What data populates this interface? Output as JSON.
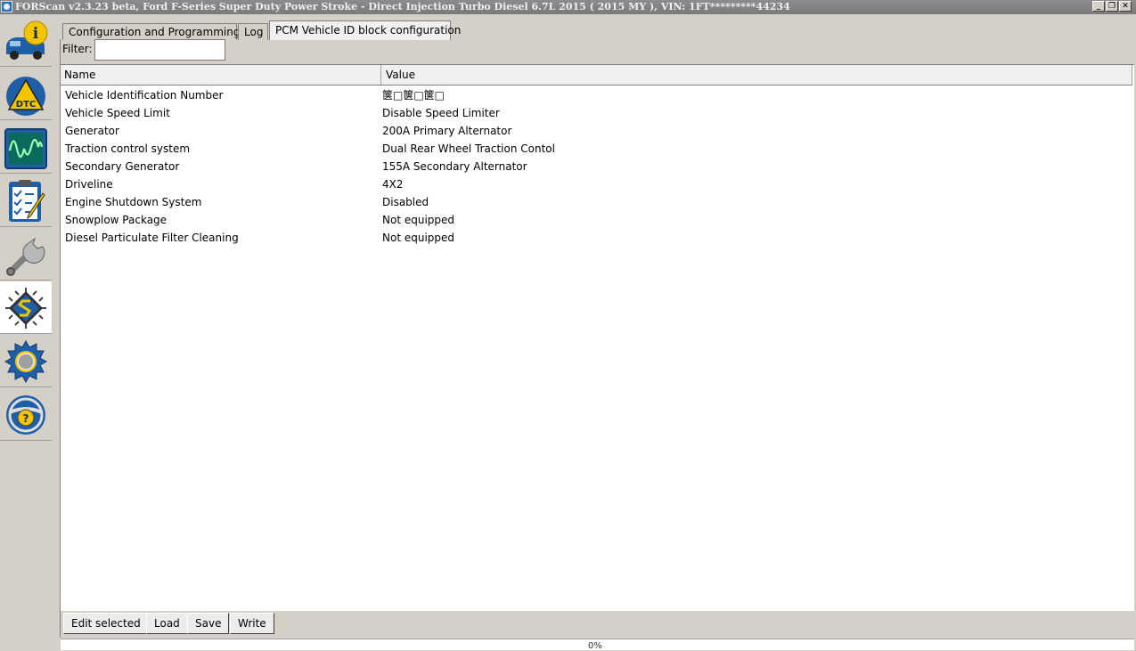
{
  "window": {
    "title": "FORScan v2.3.23 beta, Ford F-Series Super Duty Power Stroke - Direct Injection Turbo Diesel 6.7L 2015 ( 2015 MY ), VIN: 1FT*********44234",
    "controls": {
      "minimize": "_",
      "restore": "❐",
      "close": "✕"
    }
  },
  "sidebar": {
    "items": [
      {
        "name": "vehicle-info",
        "icon": "car-info-icon"
      },
      {
        "name": "dtc",
        "icon": "dtc-warning-icon"
      },
      {
        "name": "oscilloscope",
        "icon": "oscilloscope-icon"
      },
      {
        "name": "tests",
        "icon": "checklist-icon"
      },
      {
        "name": "service",
        "icon": "wrench-icon"
      },
      {
        "name": "configuration",
        "icon": "chip-icon",
        "active": true
      },
      {
        "name": "settings",
        "icon": "gear-icon"
      },
      {
        "name": "help",
        "icon": "help-steering-icon"
      }
    ],
    "dtc_label": "DTC"
  },
  "tabs": [
    {
      "label": "Configuration and Programming"
    },
    {
      "label": "Log"
    },
    {
      "label": "PCM Vehicle ID block configuration",
      "active": true
    }
  ],
  "filter": {
    "label": "Filter:",
    "value": ""
  },
  "table": {
    "headers": {
      "name": "Name",
      "value": "Value"
    },
    "rows": [
      {
        "name": "Vehicle Identification Number",
        "value": "箧□箧□箧□"
      },
      {
        "name": "Vehicle Speed Limit",
        "value": "Disable Speed Limiter"
      },
      {
        "name": "Generator",
        "value": "200A Primary Alternator"
      },
      {
        "name": "Traction control system",
        "value": "Dual Rear Wheel  Traction Contol"
      },
      {
        "name": "Secondary Generator",
        "value": "155A Secondary Alternator"
      },
      {
        "name": "Driveline",
        "value": "4X2"
      },
      {
        "name": "Engine Shutdown System",
        "value": "Disabled"
      },
      {
        "name": "Snowplow Package",
        "value": "Not equipped"
      },
      {
        "name": "Diesel Particulate Filter Cleaning",
        "value": "Not equipped"
      }
    ]
  },
  "buttons": {
    "edit": "Edit selected",
    "load": "Load",
    "save": "Save",
    "write": "Write"
  },
  "status": {
    "progress_text": "0%"
  },
  "colors": {
    "accent_blue": "#1f5fa8",
    "warning_yellow": "#f2c500",
    "sidebar_bg": "#d4d0c8"
  }
}
